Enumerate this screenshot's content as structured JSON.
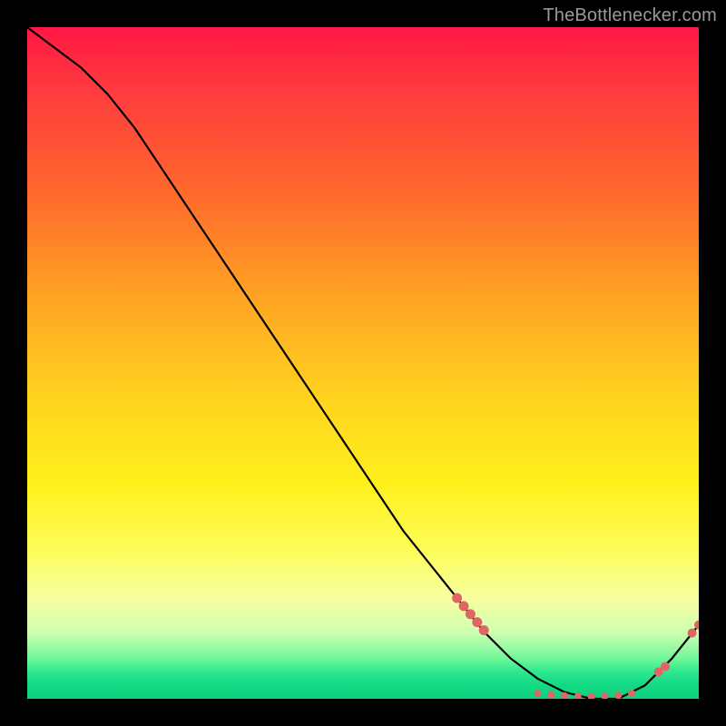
{
  "watermark": "TheBottlenecker.com",
  "colors": {
    "curve": "#000000",
    "marker": "#e06666",
    "bg": "#000000"
  },
  "chart_data": {
    "type": "line",
    "title": "",
    "xlabel": "",
    "ylabel": "",
    "xlim": [
      0,
      100
    ],
    "ylim": [
      0,
      100
    ],
    "series": [
      {
        "name": "curve",
        "x": [
          0,
          4,
          8,
          12,
          16,
          20,
          24,
          28,
          32,
          36,
          40,
          44,
          48,
          52,
          56,
          60,
          64,
          68,
          72,
          76,
          80,
          84,
          88,
          92,
          96,
          100
        ],
        "y": [
          100,
          97,
          94,
          90,
          85,
          79,
          73,
          67,
          61,
          55,
          49,
          43,
          37,
          31,
          25,
          20,
          15,
          10,
          6,
          3,
          1,
          0,
          0,
          2,
          6,
          11
        ]
      }
    ],
    "markers_left": [
      {
        "x": 64,
        "y": 15
      },
      {
        "x": 65,
        "y": 13.8
      },
      {
        "x": 66,
        "y": 12.6
      },
      {
        "x": 67,
        "y": 11.4
      },
      {
        "x": 68,
        "y": 10.2
      }
    ],
    "markers_bottom": [
      {
        "x": 76,
        "y": 0.8
      },
      {
        "x": 78,
        "y": 0.6
      },
      {
        "x": 80,
        "y": 0.45
      },
      {
        "x": 82,
        "y": 0.35
      },
      {
        "x": 84,
        "y": 0.3
      },
      {
        "x": 86,
        "y": 0.35
      },
      {
        "x": 88,
        "y": 0.5
      },
      {
        "x": 90,
        "y": 0.8
      }
    ],
    "markers_right": [
      {
        "x": 94,
        "y": 4.0
      },
      {
        "x": 95,
        "y": 4.8
      },
      {
        "x": 99,
        "y": 9.8
      },
      {
        "x": 100,
        "y": 11.0
      }
    ]
  }
}
